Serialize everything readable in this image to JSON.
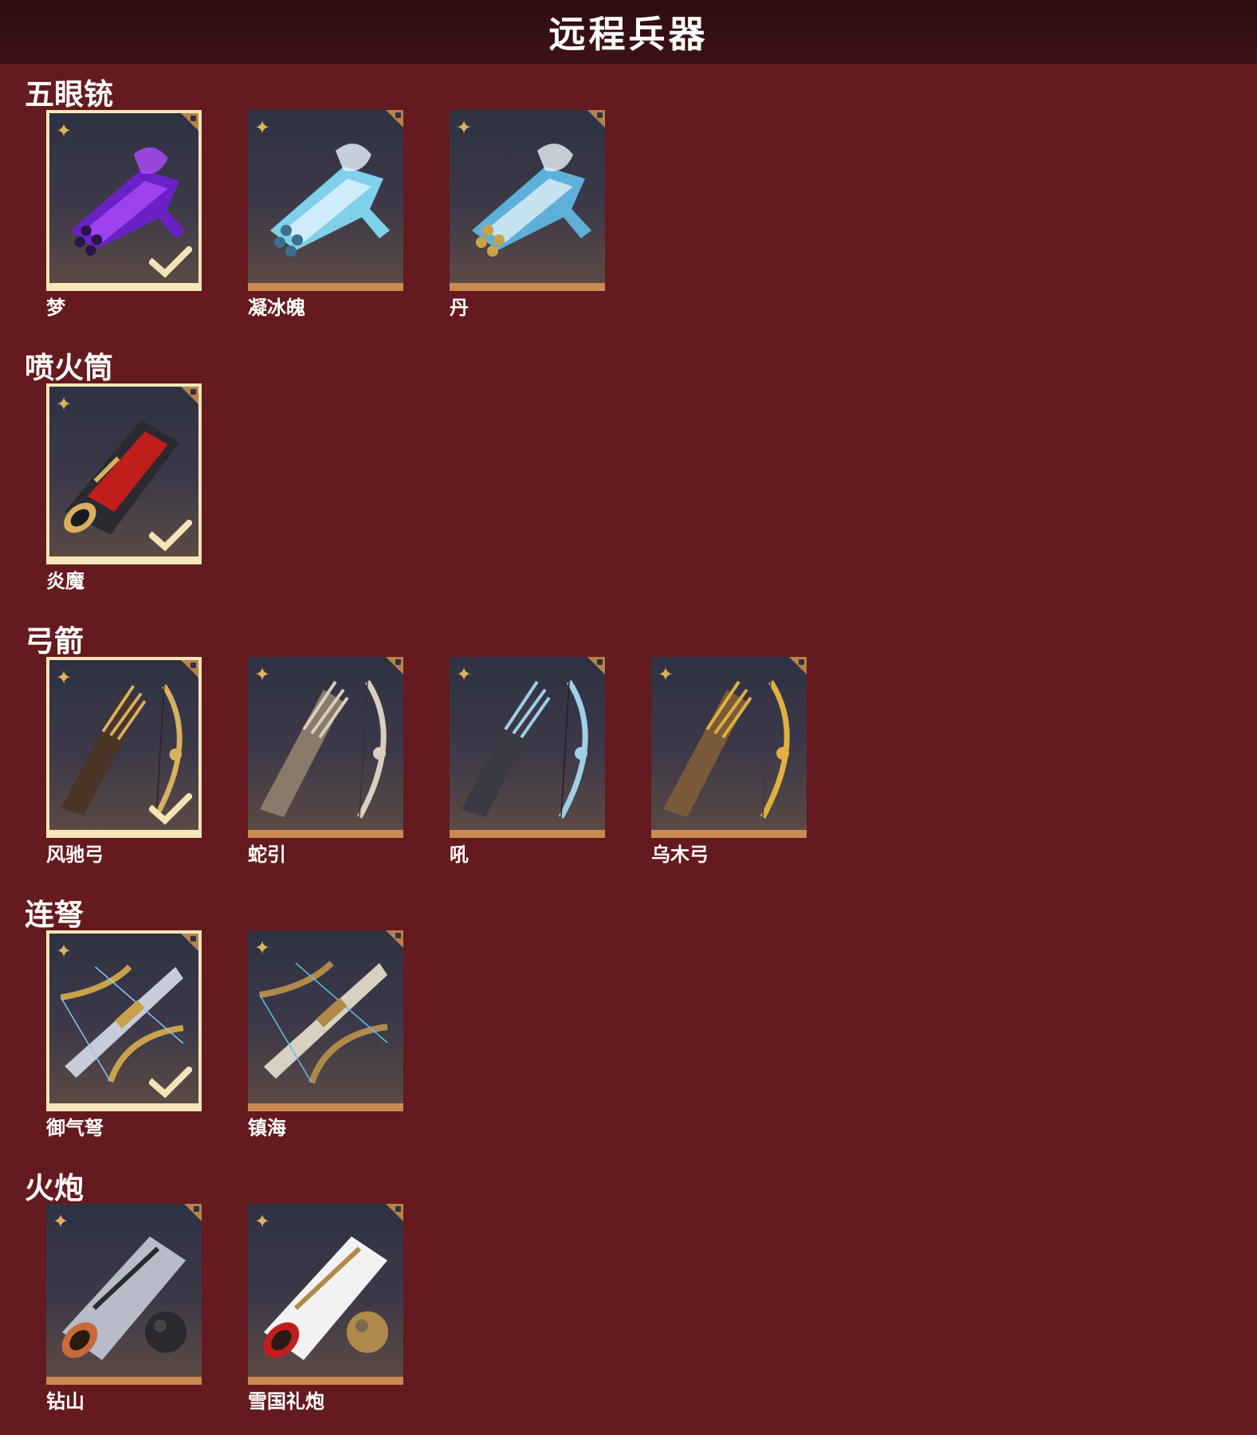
{
  "header": {
    "title": "远程兵器"
  },
  "sections": [
    {
      "title": "五眼铳",
      "items": [
        {
          "name": "梦",
          "selected": true,
          "art": "gun",
          "colors": [
            "#6a22c8",
            "#b04cff",
            "#2a1640"
          ]
        },
        {
          "name": "凝冰魄",
          "selected": false,
          "art": "gun",
          "colors": [
            "#7fd0ea",
            "#e8f6ff",
            "#3a6f8f"
          ]
        },
        {
          "name": "丹",
          "selected": false,
          "art": "gun",
          "colors": [
            "#5fb0d8",
            "#e8f2f8",
            "#c9a24b"
          ]
        }
      ]
    },
    {
      "title": "喷火筒",
      "items": [
        {
          "name": "炎魔",
          "selected": true,
          "art": "tube",
          "colors": [
            "#c21d1d",
            "#d8b060",
            "#2a2a30"
          ]
        }
      ]
    },
    {
      "title": "弓箭",
      "items": [
        {
          "name": "风驰弓",
          "selected": true,
          "art": "bow",
          "colors": [
            "#4a3526",
            "#d8b060",
            "#2a2222"
          ]
        },
        {
          "name": "蛇引",
          "selected": false,
          "art": "bow",
          "colors": [
            "#8a7a6a",
            "#d8cfc0",
            "#3a3230"
          ]
        },
        {
          "name": "吼",
          "selected": false,
          "art": "bow",
          "colors": [
            "#3a3a44",
            "#9fd0e8",
            "#1e2028"
          ]
        },
        {
          "name": "乌木弓",
          "selected": false,
          "art": "bow",
          "colors": [
            "#7a5a3a",
            "#e0b040",
            "#4a3050"
          ]
        }
      ]
    },
    {
      "title": "连弩",
      "items": [
        {
          "name": "御气弩",
          "selected": true,
          "art": "crossbow",
          "colors": [
            "#c8ccd8",
            "#8fc8ff",
            "#c9a24b"
          ]
        },
        {
          "name": "镇海",
          "selected": false,
          "art": "crossbow",
          "colors": [
            "#d8d0c0",
            "#5fc0e8",
            "#b08a4a"
          ]
        }
      ]
    },
    {
      "title": "火炮",
      "items": [
        {
          "name": "钻山",
          "selected": false,
          "art": "cannon",
          "colors": [
            "#b8bcc8",
            "#c96a3a",
            "#2a2a2e"
          ]
        },
        {
          "name": "雪国礼炮",
          "selected": false,
          "art": "cannon",
          "colors": [
            "#f2f2f2",
            "#c21d1d",
            "#b08a4a"
          ]
        }
      ]
    }
  ]
}
